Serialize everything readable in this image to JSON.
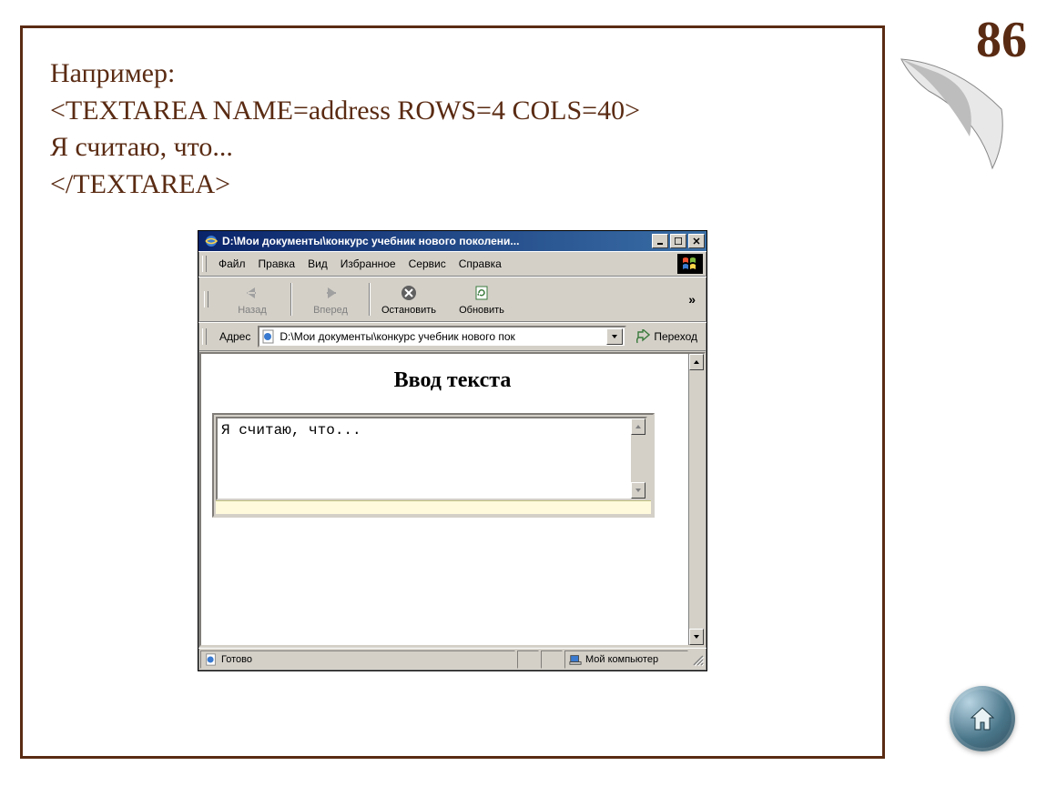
{
  "page_number": "86",
  "code_example": {
    "line1": "Например:",
    "line2": "<TEXTAREA NAME=address ROWS=4 COLS=40>",
    "line3": "Я считаю, что...",
    "line4": "</TEXTAREA>"
  },
  "ie_window": {
    "title": "D:\\Мои документы\\конкурс учебник нового поколени...",
    "menus": {
      "file": "Файл",
      "edit": "Правка",
      "view": "Вид",
      "favorites": "Избранное",
      "tools": "Сервис",
      "help": "Справка"
    },
    "toolbar": {
      "back": "Назад",
      "forward": "Вперед",
      "stop": "Остановить",
      "refresh": "Обновить"
    },
    "address_label": "Адрес",
    "address_value": "D:\\Мои документы\\конкурс учебник нового пок",
    "go_label": "Переход",
    "content": {
      "heading": "Ввод текста",
      "textarea_value": "Я считаю, что..."
    },
    "status": {
      "ready": "Готово",
      "zone": "Мой компьютер"
    }
  }
}
